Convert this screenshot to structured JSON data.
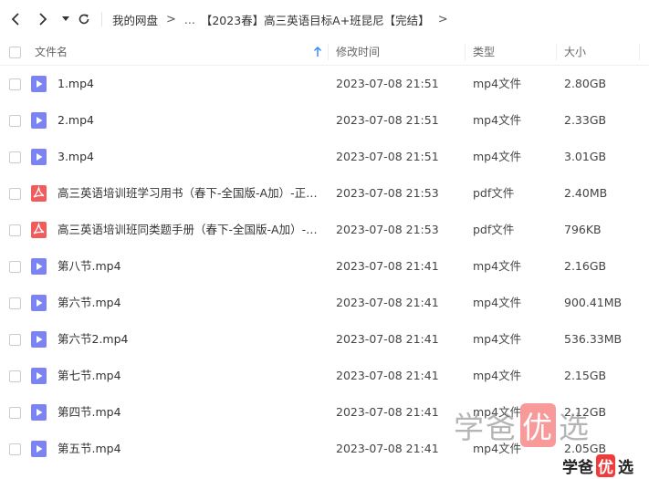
{
  "breadcrumb": {
    "root": "我的网盘",
    "ellipsis": "...",
    "current": "【2023春】高三英语目标A+班昆尼【完结】",
    "sep": ">"
  },
  "columns": {
    "name": "文件名",
    "time": "修改时间",
    "type": "类型",
    "size": "大小"
  },
  "files": [
    {
      "name": "1.mp4",
      "time": "2023-07-08 21:51",
      "type": "mp4文件",
      "size": "2.80GB",
      "icon": "video"
    },
    {
      "name": "2.mp4",
      "time": "2023-07-08 21:51",
      "type": "mp4文件",
      "size": "2.33GB",
      "icon": "video"
    },
    {
      "name": "3.mp4",
      "time": "2023-07-08 21:51",
      "type": "mp4文件",
      "size": "3.01GB",
      "icon": "video"
    },
    {
      "name": "高三英语培训班学习用书（春下-全国版-A加）-正文...",
      "time": "2023-07-08 21:53",
      "type": "pdf文件",
      "size": "2.40MB",
      "icon": "pdf"
    },
    {
      "name": "高三英语培训班同类题手册（春下-全国版-A加）-正...",
      "time": "2023-07-08 21:53",
      "type": "pdf文件",
      "size": "796KB",
      "icon": "pdf"
    },
    {
      "name": "第八节.mp4",
      "time": "2023-07-08 21:41",
      "type": "mp4文件",
      "size": "2.16GB",
      "icon": "video"
    },
    {
      "name": "第六节.mp4",
      "time": "2023-07-08 21:41",
      "type": "mp4文件",
      "size": "900.41MB",
      "icon": "video"
    },
    {
      "name": "第六节2.mp4",
      "time": "2023-07-08 21:41",
      "type": "mp4文件",
      "size": "536.33MB",
      "icon": "video"
    },
    {
      "name": "第七节.mp4",
      "time": "2023-07-08 21:41",
      "type": "mp4文件",
      "size": "2.15GB",
      "icon": "video"
    },
    {
      "name": "第四节.mp4",
      "time": "2023-07-08 21:41",
      "type": "mp4文件",
      "size": "2.12GB",
      "icon": "video"
    },
    {
      "name": "第五节.mp4",
      "time": "2023-07-08 21:41",
      "type": "mp4文件",
      "size": "2.05GB",
      "icon": "video"
    }
  ],
  "watermark": {
    "text_a": "学爸",
    "text_b": "优",
    "text_c": "选"
  },
  "colors": {
    "video_icon": "#7c83f2",
    "pdf_icon": "#f25b5b",
    "sort_arrow": "#3b8cf5"
  }
}
